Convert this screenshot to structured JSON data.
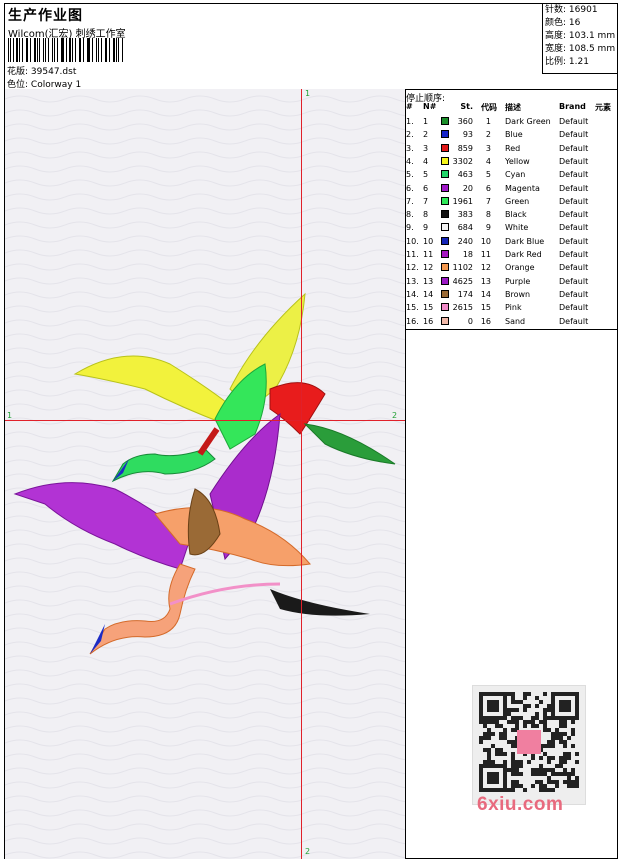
{
  "header": {
    "title": "生产作业图",
    "company": "Wilcom(汇宏) 刺绣工作室",
    "design_label": "花版:",
    "design_value": "39547.dst",
    "colorway_label": "色位:",
    "colorway_value": "Colorway 1"
  },
  "stats": {
    "stitches_label": "针数:",
    "stitches_value": "16901",
    "colors_label": "颜色:",
    "colors_value": "16",
    "height_label": "高度:",
    "height_value": "103.1 mm",
    "width_label": "宽度:",
    "width_value": "108.5 mm",
    "scale_label": "比例:",
    "scale_value": "1.21"
  },
  "canvas": {
    "guide_top": "1",
    "guide_bottom": "2",
    "guide_left": "1",
    "guide_right": "2"
  },
  "stop_sequence": {
    "title": "停止顺序:",
    "headers": {
      "num": "#",
      "n": "N#",
      "st": "St.",
      "code": "代码",
      "desc": "描述",
      "brand": "Brand",
      "extra": "元素"
    },
    "rows": [
      {
        "num": "1.",
        "n": "1",
        "st": "360",
        "code": "1",
        "desc": "Dark Green",
        "brand": "Default",
        "color": "#1a8f2a"
      },
      {
        "num": "2.",
        "n": "2",
        "st": "93",
        "code": "2",
        "desc": "Blue",
        "brand": "Default",
        "color": "#1524c9"
      },
      {
        "num": "3.",
        "n": "3",
        "st": "859",
        "code": "3",
        "desc": "Red",
        "brand": "Default",
        "color": "#e01818"
      },
      {
        "num": "4.",
        "n": "4",
        "st": "3302",
        "code": "4",
        "desc": "Yellow",
        "brand": "Default",
        "color": "#f5f51a"
      },
      {
        "num": "5.",
        "n": "5",
        "st": "463",
        "code": "5",
        "desc": "Cyan",
        "brand": "Default",
        "color": "#22d66a"
      },
      {
        "num": "6.",
        "n": "6",
        "st": "20",
        "code": "6",
        "desc": "Magenta",
        "brand": "Default",
        "color": "#a018c8"
      },
      {
        "num": "7.",
        "n": "7",
        "st": "1961",
        "code": "7",
        "desc": "Green",
        "brand": "Default",
        "color": "#2ee858"
      },
      {
        "num": "8.",
        "n": "8",
        "st": "383",
        "code": "8",
        "desc": "Black",
        "brand": "Default",
        "color": "#111111"
      },
      {
        "num": "9.",
        "n": "9",
        "st": "684",
        "code": "9",
        "desc": "White",
        "brand": "Default",
        "color": "#f4f4f4"
      },
      {
        "num": "10.",
        "n": "10",
        "st": "240",
        "code": "10",
        "desc": "Dark Blue",
        "brand": "Default",
        "color": "#1424b8"
      },
      {
        "num": "11.",
        "n": "11",
        "st": "18",
        "code": "11",
        "desc": "Dark Red",
        "brand": "Default",
        "color": "#a516c0"
      },
      {
        "num": "12.",
        "n": "12",
        "st": "1102",
        "code": "12",
        "desc": "Orange",
        "brand": "Default",
        "color": "#f4984e"
      },
      {
        "num": "13.",
        "n": "13",
        "st": "4625",
        "code": "13",
        "desc": "Purple",
        "brand": "Default",
        "color": "#9a18c4"
      },
      {
        "num": "14.",
        "n": "14",
        "st": "174",
        "code": "14",
        "desc": "Brown",
        "brand": "Default",
        "color": "#9a6a36"
      },
      {
        "num": "15.",
        "n": "15",
        "st": "2615",
        "code": "15",
        "desc": "Pink",
        "brand": "Default",
        "color": "#f08ac8"
      },
      {
        "num": "16.",
        "n": "16",
        "st": "0",
        "code": "16",
        "desc": "Sand",
        "brand": "Default",
        "color": "#f0b8a8"
      }
    ]
  },
  "watermark": {
    "site": "6xiu.com"
  }
}
